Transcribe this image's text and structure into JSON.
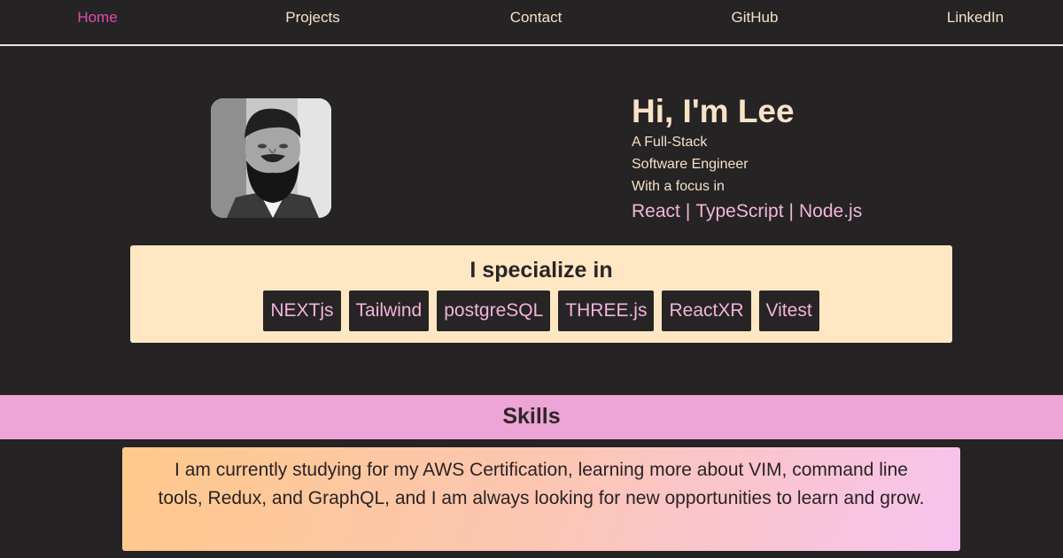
{
  "nav": {
    "items": [
      {
        "label": "Home",
        "active": true
      },
      {
        "label": "Projects",
        "active": false
      },
      {
        "label": "Contact",
        "active": false
      },
      {
        "label": "GitHub",
        "active": false
      },
      {
        "label": "LinkedIn",
        "active": false
      }
    ]
  },
  "hero": {
    "greeting": "Hi, I'm Lee",
    "line1": "A Full-Stack",
    "line2": "Software Engineer",
    "line3": "With a focus in",
    "focus": [
      "React",
      "TypeScript",
      "Node.js"
    ],
    "separator": "|"
  },
  "specialize": {
    "title": "I specialize in",
    "badges": [
      "NEXTjs",
      "Tailwind",
      "postgreSQL",
      "THREE.js",
      "ReactXR",
      "Vitest"
    ]
  },
  "skills": {
    "title": "Skills",
    "description": "I am currently studying for my AWS Certification, learning more about VIM, command line tools, Redux, and GraphQL, and I am always looking for new opportunities to learn and grow."
  },
  "colors": {
    "background": "#252324",
    "nav_text": "#f6e1c5",
    "nav_active": "#e24ba9",
    "accent_pink": "#f2b6dc",
    "card_cream": "#ffe7c4",
    "skills_bar": "#eca5d6"
  },
  "icons": {
    "avatar": "profile-photo"
  }
}
